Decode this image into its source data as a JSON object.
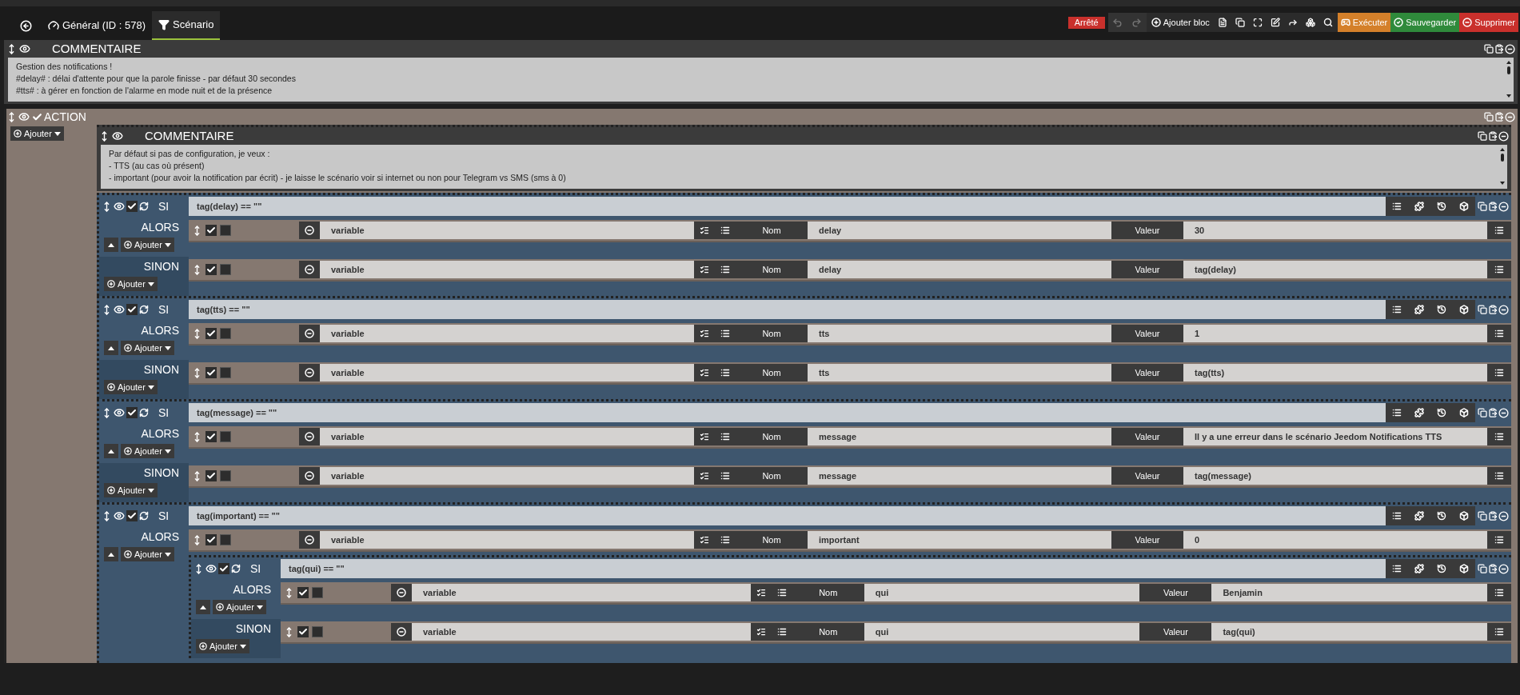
{
  "top_bar": {
    "tabs": [
      {
        "kind": "general",
        "label": "Général (ID : 578)",
        "selected": false
      },
      {
        "kind": "scenario",
        "label": "Scénario",
        "selected": true
      }
    ],
    "status": "Arrêté",
    "history": [
      {
        "kind": "undo",
        "disabled": true
      },
      {
        "kind": "redo",
        "disabled": true
      }
    ],
    "add_block": "Ajouter bloc",
    "buttons": [
      {
        "kind": "execute",
        "label": "Exécuter"
      },
      {
        "kind": "save",
        "label": "Sauvegarder"
      },
      {
        "kind": "delete",
        "label": "Supprimer"
      }
    ]
  },
  "comment": {
    "title": "COMMENTAIRE",
    "lines": [
      "Gestion des notifications !",
      "#delay# : délai d'attente pour que la parole finisse - par défaut 30 secondes",
      "#tts# : à gérer en fonction de l'alarme en mode nuit et de la présence"
    ]
  },
  "action": {
    "title": "ACTION",
    "enabled": true,
    "add": "Ajouter",
    "blocks": [
      {
        "kind": "comment",
        "title": "COMMENTAIRE",
        "lines": [
          "Par défaut si pas de configuration, je veux :",
          "- TTS (au cas où présent)",
          "- important (pour avoir la notification par écrit) - je laisse le scénario voir si internet ou non pour Telegram vs SMS (sms à 0)"
        ]
      },
      {
        "kind": "if",
        "label": "SI",
        "enabled": true,
        "condition": "tag(delay) == \"\"",
        "then": {
          "label": "ALORS",
          "add": "Ajouter",
          "items": [
            {
              "kind": "action",
              "enabled": true,
              "parallel": false,
              "type": "variable",
              "name_label": "Nom",
              "name": "delay",
              "value_label": "Valeur",
              "value": "30"
            }
          ]
        },
        "else": {
          "label": "SINON",
          "add": "Ajouter",
          "items": [
            {
              "kind": "action",
              "enabled": true,
              "parallel": false,
              "type": "variable",
              "name_label": "Nom",
              "name": "delay",
              "value_label": "Valeur",
              "value": "tag(delay)"
            }
          ]
        }
      },
      {
        "kind": "if",
        "label": "SI",
        "enabled": true,
        "condition": "tag(tts) == \"\"",
        "then": {
          "label": "ALORS",
          "add": "Ajouter",
          "items": [
            {
              "kind": "action",
              "enabled": true,
              "parallel": false,
              "type": "variable",
              "name_label": "Nom",
              "name": "tts",
              "value_label": "Valeur",
              "value": "1"
            }
          ]
        },
        "else": {
          "label": "SINON",
          "add": "Ajouter",
          "items": [
            {
              "kind": "action",
              "enabled": true,
              "parallel": false,
              "type": "variable",
              "name_label": "Nom",
              "name": "tts",
              "value_label": "Valeur",
              "value": "tag(tts)"
            }
          ]
        }
      },
      {
        "kind": "if",
        "label": "SI",
        "enabled": true,
        "condition": "tag(message) == \"\"",
        "then": {
          "label": "ALORS",
          "add": "Ajouter",
          "items": [
            {
              "kind": "action",
              "enabled": true,
              "parallel": false,
              "type": "variable",
              "name_label": "Nom",
              "name": "message",
              "value_label": "Valeur",
              "value": "Il y a une erreur dans le scénario Jeedom Notifications TTS"
            }
          ]
        },
        "else": {
          "label": "SINON",
          "add": "Ajouter",
          "items": [
            {
              "kind": "action",
              "enabled": true,
              "parallel": false,
              "type": "variable",
              "name_label": "Nom",
              "name": "message",
              "value_label": "Valeur",
              "value": "tag(message)"
            }
          ]
        }
      },
      {
        "kind": "if",
        "label": "SI",
        "enabled": true,
        "condition": "tag(important) == \"\"",
        "then": {
          "label": "ALORS",
          "add": "Ajouter",
          "items": [
            {
              "kind": "action",
              "enabled": true,
              "parallel": false,
              "type": "variable",
              "name_label": "Nom",
              "name": "important",
              "value_label": "Valeur",
              "value": "0"
            },
            {
              "kind": "if",
              "label": "SI",
              "enabled": true,
              "condition": "tag(qui) == \"\"",
              "then": {
                "label": "ALORS",
                "add": "Ajouter",
                "items": [
                  {
                    "kind": "action",
                    "enabled": true,
                    "parallel": false,
                    "type": "variable",
                    "name_label": "Nom",
                    "name": "qui",
                    "value_label": "Valeur",
                    "value": "Benjamin"
                  }
                ]
              },
              "else": {
                "label": "SINON",
                "add": "Ajouter",
                "items": [
                  {
                    "kind": "action",
                    "enabled": true,
                    "parallel": false,
                    "type": "variable",
                    "name_label": "Nom",
                    "name": "qui",
                    "value_label": "Valeur",
                    "value": "tag(qui)"
                  }
                ]
              }
            }
          ]
        }
      }
    ]
  }
}
